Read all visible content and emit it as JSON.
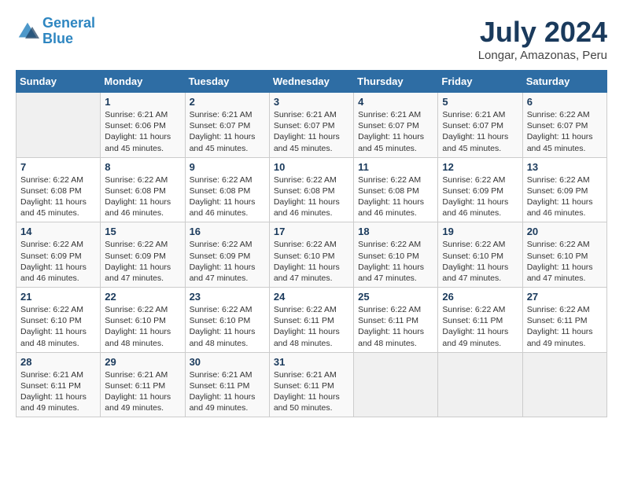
{
  "logo": {
    "line1": "General",
    "line2": "Blue"
  },
  "title": "July 2024",
  "location": "Longar, Amazonas, Peru",
  "days_header": [
    "Sunday",
    "Monday",
    "Tuesday",
    "Wednesday",
    "Thursday",
    "Friday",
    "Saturday"
  ],
  "weeks": [
    [
      {
        "day": "",
        "info": ""
      },
      {
        "day": "1",
        "info": "Sunrise: 6:21 AM\nSunset: 6:06 PM\nDaylight: 11 hours\nand 45 minutes."
      },
      {
        "day": "2",
        "info": "Sunrise: 6:21 AM\nSunset: 6:07 PM\nDaylight: 11 hours\nand 45 minutes."
      },
      {
        "day": "3",
        "info": "Sunrise: 6:21 AM\nSunset: 6:07 PM\nDaylight: 11 hours\nand 45 minutes."
      },
      {
        "day": "4",
        "info": "Sunrise: 6:21 AM\nSunset: 6:07 PM\nDaylight: 11 hours\nand 45 minutes."
      },
      {
        "day": "5",
        "info": "Sunrise: 6:21 AM\nSunset: 6:07 PM\nDaylight: 11 hours\nand 45 minutes."
      },
      {
        "day": "6",
        "info": "Sunrise: 6:22 AM\nSunset: 6:07 PM\nDaylight: 11 hours\nand 45 minutes."
      }
    ],
    [
      {
        "day": "7",
        "info": "Sunrise: 6:22 AM\nSunset: 6:08 PM\nDaylight: 11 hours\nand 45 minutes."
      },
      {
        "day": "8",
        "info": "Sunrise: 6:22 AM\nSunset: 6:08 PM\nDaylight: 11 hours\nand 46 minutes."
      },
      {
        "day": "9",
        "info": "Sunrise: 6:22 AM\nSunset: 6:08 PM\nDaylight: 11 hours\nand 46 minutes."
      },
      {
        "day": "10",
        "info": "Sunrise: 6:22 AM\nSunset: 6:08 PM\nDaylight: 11 hours\nand 46 minutes."
      },
      {
        "day": "11",
        "info": "Sunrise: 6:22 AM\nSunset: 6:08 PM\nDaylight: 11 hours\nand 46 minutes."
      },
      {
        "day": "12",
        "info": "Sunrise: 6:22 AM\nSunset: 6:09 PM\nDaylight: 11 hours\nand 46 minutes."
      },
      {
        "day": "13",
        "info": "Sunrise: 6:22 AM\nSunset: 6:09 PM\nDaylight: 11 hours\nand 46 minutes."
      }
    ],
    [
      {
        "day": "14",
        "info": "Sunrise: 6:22 AM\nSunset: 6:09 PM\nDaylight: 11 hours\nand 46 minutes."
      },
      {
        "day": "15",
        "info": "Sunrise: 6:22 AM\nSunset: 6:09 PM\nDaylight: 11 hours\nand 47 minutes."
      },
      {
        "day": "16",
        "info": "Sunrise: 6:22 AM\nSunset: 6:09 PM\nDaylight: 11 hours\nand 47 minutes."
      },
      {
        "day": "17",
        "info": "Sunrise: 6:22 AM\nSunset: 6:10 PM\nDaylight: 11 hours\nand 47 minutes."
      },
      {
        "day": "18",
        "info": "Sunrise: 6:22 AM\nSunset: 6:10 PM\nDaylight: 11 hours\nand 47 minutes."
      },
      {
        "day": "19",
        "info": "Sunrise: 6:22 AM\nSunset: 6:10 PM\nDaylight: 11 hours\nand 47 minutes."
      },
      {
        "day": "20",
        "info": "Sunrise: 6:22 AM\nSunset: 6:10 PM\nDaylight: 11 hours\nand 47 minutes."
      }
    ],
    [
      {
        "day": "21",
        "info": "Sunrise: 6:22 AM\nSunset: 6:10 PM\nDaylight: 11 hours\nand 48 minutes."
      },
      {
        "day": "22",
        "info": "Sunrise: 6:22 AM\nSunset: 6:10 PM\nDaylight: 11 hours\nand 48 minutes."
      },
      {
        "day": "23",
        "info": "Sunrise: 6:22 AM\nSunset: 6:10 PM\nDaylight: 11 hours\nand 48 minutes."
      },
      {
        "day": "24",
        "info": "Sunrise: 6:22 AM\nSunset: 6:11 PM\nDaylight: 11 hours\nand 48 minutes."
      },
      {
        "day": "25",
        "info": "Sunrise: 6:22 AM\nSunset: 6:11 PM\nDaylight: 11 hours\nand 48 minutes."
      },
      {
        "day": "26",
        "info": "Sunrise: 6:22 AM\nSunset: 6:11 PM\nDaylight: 11 hours\nand 49 minutes."
      },
      {
        "day": "27",
        "info": "Sunrise: 6:22 AM\nSunset: 6:11 PM\nDaylight: 11 hours\nand 49 minutes."
      }
    ],
    [
      {
        "day": "28",
        "info": "Sunrise: 6:21 AM\nSunset: 6:11 PM\nDaylight: 11 hours\nand 49 minutes."
      },
      {
        "day": "29",
        "info": "Sunrise: 6:21 AM\nSunset: 6:11 PM\nDaylight: 11 hours\nand 49 minutes."
      },
      {
        "day": "30",
        "info": "Sunrise: 6:21 AM\nSunset: 6:11 PM\nDaylight: 11 hours\nand 49 minutes."
      },
      {
        "day": "31",
        "info": "Sunrise: 6:21 AM\nSunset: 6:11 PM\nDaylight: 11 hours\nand 50 minutes."
      },
      {
        "day": "",
        "info": ""
      },
      {
        "day": "",
        "info": ""
      },
      {
        "day": "",
        "info": ""
      }
    ]
  ]
}
